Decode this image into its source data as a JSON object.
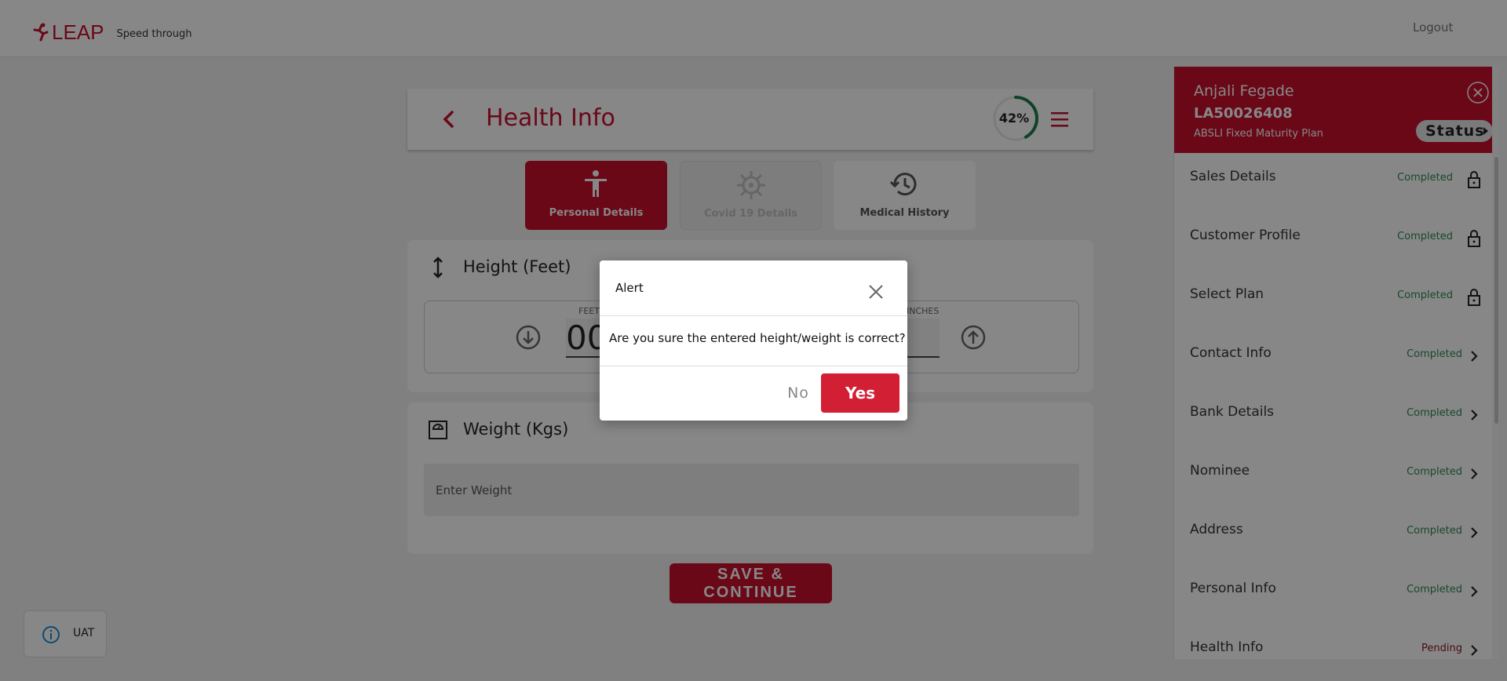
{
  "app": {
    "brand": "LEAP",
    "tagline": "Speed through",
    "logout_label": "Logout",
    "accent": "#c8102e"
  },
  "header": {
    "title": "Health Info",
    "progress_percent": 42,
    "progress_label": "42%",
    "back_icon": "chevron-left-icon",
    "menu_icon": "hamburger-menu-icon"
  },
  "tabs": [
    {
      "label": "Personal Details",
      "icon": "person-icon",
      "state": "active"
    },
    {
      "label": "Covid 19 Details",
      "icon": "virus-icon",
      "state": "disabled"
    },
    {
      "label": "Medical History",
      "icon": "history-icon",
      "state": "inactive"
    }
  ],
  "height": {
    "title": "Height (Feet)",
    "feet_label": "FEET",
    "feet_value": "00",
    "inches_label": "INCHES"
  },
  "weight": {
    "title": "Weight (Kgs)",
    "placeholder": "Enter Weight"
  },
  "save_label": "SAVE & CONTINUE",
  "env_badge": {
    "label": "UAT",
    "icon": "info-icon"
  },
  "right_panel": {
    "name": "Anjali Fegade",
    "application_id": "LA50026408",
    "plan": "ABSLI Fixed Maturity Plan",
    "status_label": "Status",
    "items": [
      {
        "label": "Sales Details",
        "status": "Completed",
        "icon": "lock-icon"
      },
      {
        "label": "Customer Profile",
        "status": "Completed",
        "icon": "lock-icon"
      },
      {
        "label": "Select Plan",
        "status": "Completed",
        "icon": "lock-icon"
      },
      {
        "label": "Contact Info",
        "status": "Completed",
        "icon": "chevron-right-icon"
      },
      {
        "label": "Bank Details",
        "status": "Completed",
        "icon": "chevron-right-icon"
      },
      {
        "label": "Nominee",
        "status": "Completed",
        "icon": "chevron-right-icon"
      },
      {
        "label": "Address",
        "status": "Completed",
        "icon": "chevron-right-icon"
      },
      {
        "label": "Personal Info",
        "status": "Completed",
        "icon": "chevron-right-icon"
      },
      {
        "label": "Health Info",
        "status": "Pending",
        "icon": "chevron-right-icon"
      }
    ]
  },
  "modal": {
    "title": "Alert",
    "message": "Are you sure the entered height/weight is correct?",
    "no_label": "No",
    "yes_label": "Yes"
  }
}
